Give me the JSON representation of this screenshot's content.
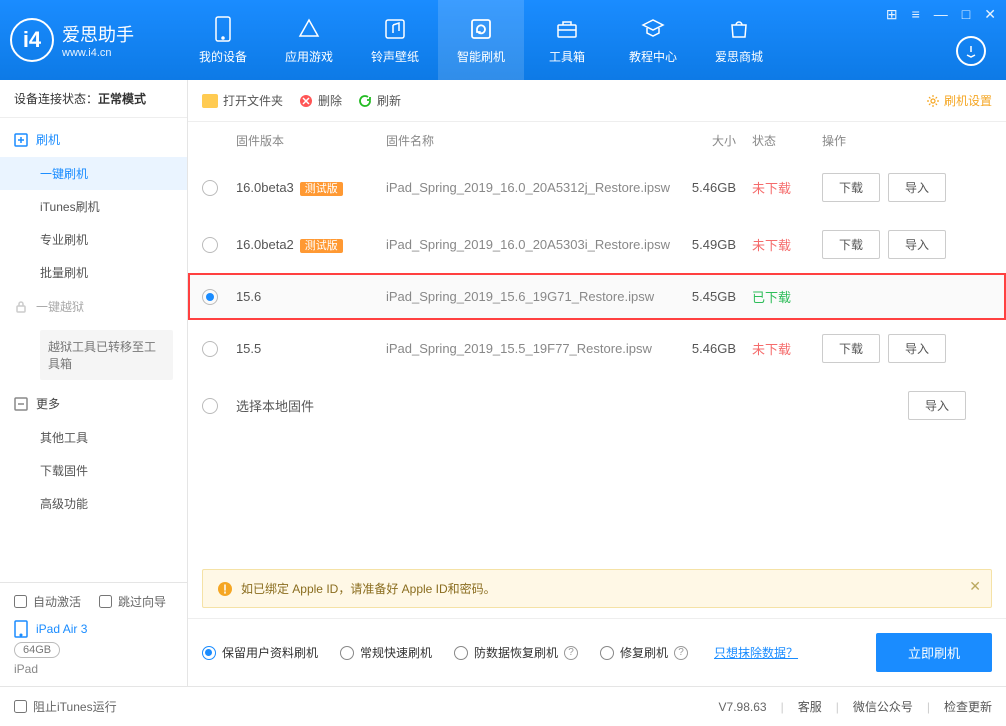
{
  "header": {
    "app_name": "爱思助手",
    "app_url": "www.i4.cn",
    "nav": [
      {
        "label": "我的设备"
      },
      {
        "label": "应用游戏"
      },
      {
        "label": "铃声壁纸"
      },
      {
        "label": "智能刷机"
      },
      {
        "label": "工具箱"
      },
      {
        "label": "教程中心"
      },
      {
        "label": "爱思商城"
      }
    ]
  },
  "sidebar": {
    "conn_label": "设备连接状态：",
    "conn_value": "正常模式",
    "flash": {
      "label": "刷机"
    },
    "flash_subs": [
      "一键刷机",
      "iTunes刷机",
      "专业刷机",
      "批量刷机"
    ],
    "jailbreak": {
      "label": "一键越狱",
      "notice": "越狱工具已转移至工具箱"
    },
    "more": {
      "label": "更多",
      "subs": [
        "其他工具",
        "下载固件",
        "高级功能"
      ]
    },
    "auto_activate": "自动激活",
    "skip_guide": "跳过向导",
    "device_name": "iPad Air 3",
    "device_storage": "64GB",
    "device_type": "iPad"
  },
  "toolbar": {
    "open_folder": "打开文件夹",
    "delete": "删除",
    "refresh": "刷新",
    "settings": "刷机设置"
  },
  "table": {
    "headers": {
      "version": "固件版本",
      "name": "固件名称",
      "size": "大小",
      "status": "状态",
      "ops": "操作"
    },
    "beta_tag": "测试版",
    "btn_download": "下载",
    "btn_import": "导入",
    "rows": [
      {
        "ver": "16.0beta3",
        "beta": true,
        "name": "iPad_Spring_2019_16.0_20A5312j_Restore.ipsw",
        "size": "5.46GB",
        "status": "未下载",
        "dl": true
      },
      {
        "ver": "16.0beta2",
        "beta": true,
        "name": "iPad_Spring_2019_16.0_20A5303i_Restore.ipsw",
        "size": "5.49GB",
        "status": "未下载",
        "dl": true
      },
      {
        "ver": "15.6",
        "beta": false,
        "name": "iPad_Spring_2019_15.6_19G71_Restore.ipsw",
        "size": "5.45GB",
        "status": "已下载",
        "dl": false,
        "selected": true
      },
      {
        "ver": "15.5",
        "beta": false,
        "name": "iPad_Spring_2019_15.5_19F77_Restore.ipsw",
        "size": "5.46GB",
        "status": "未下载",
        "dl": true
      }
    ],
    "local_row": "选择本地固件"
  },
  "notice": "如已绑定 Apple ID，请准备好 Apple ID和密码。",
  "flash_options": {
    "opts": [
      "保留用户资料刷机",
      "常规快速刷机",
      "防数据恢复刷机",
      "修复刷机"
    ],
    "link": "只想抹除数据？",
    "action": "立即刷机"
  },
  "footer": {
    "block_itunes": "阻止iTunes运行",
    "version": "V7.98.63",
    "links": [
      "客服",
      "微信公众号",
      "检查更新"
    ]
  }
}
